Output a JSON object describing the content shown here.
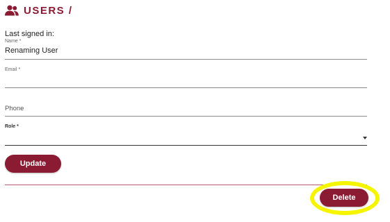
{
  "header": {
    "icon": "users-icon",
    "title": "USERS /"
  },
  "last_signed_in_label": "Last signed in:",
  "form": {
    "name": {
      "label": "Name *",
      "value": "Renaming User"
    },
    "email": {
      "label": "Email *",
      "value": ""
    },
    "phone": {
      "placeholder": "Phone",
      "value": ""
    },
    "role": {
      "label": "Role *",
      "value": ""
    }
  },
  "buttons": {
    "update": "Update",
    "delete": "Delete"
  },
  "colors": {
    "accent": "#8b1a33",
    "highlight": "#f5f500"
  }
}
